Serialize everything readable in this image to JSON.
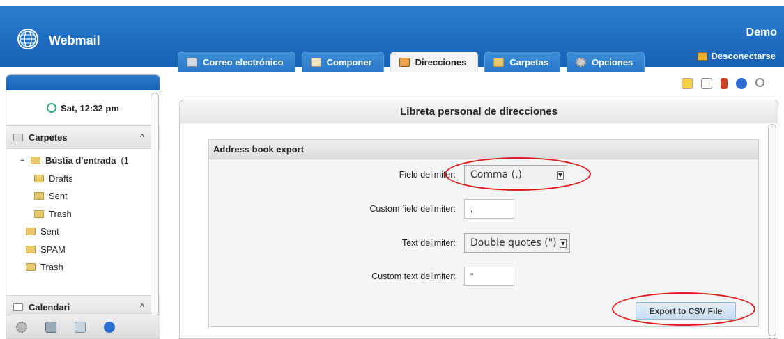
{
  "header": {
    "app_title": "Webmail",
    "user_name": "Demo",
    "logout_label": "Desconectarse",
    "tabs": [
      {
        "label": "Correo electrónico",
        "icon": "mail-icon",
        "active": false
      },
      {
        "label": "Componer",
        "icon": "compose-icon",
        "active": false
      },
      {
        "label": "Direcciones",
        "icon": "addressbook-icon",
        "active": true
      },
      {
        "label": "Carpetas",
        "icon": "folder-icon",
        "active": false
      },
      {
        "label": "Opciones",
        "icon": "gear-icon",
        "active": false
      }
    ]
  },
  "sidebar": {
    "clock": "Sat, 12:32 pm",
    "folders_section": "Carpetes",
    "folders": [
      {
        "label": "Bústia d'entrada",
        "suffix": "(1",
        "bold": true
      },
      {
        "label": "Drafts"
      },
      {
        "label": "Sent"
      },
      {
        "label": "Trash"
      },
      {
        "label": "Sent"
      },
      {
        "label": "SPAM"
      },
      {
        "label": "Trash"
      }
    ],
    "calendar_section": "Calendari"
  },
  "main": {
    "panel_title": "Libreta personal de direcciones",
    "export_box_title": "Address book export",
    "field_delimiter_label": "Field delimiter:",
    "field_delimiter_value": "Comma (,)",
    "custom_field_delimiter_label": "Custom field delimiter:",
    "custom_field_delimiter_value": ",",
    "text_delimiter_label": "Text delimiter:",
    "text_delimiter_value": "Double quotes (\")",
    "custom_text_delimiter_label": "Custom text delimiter:",
    "custom_text_delimiter_value": "\"",
    "export_button_label": "Export to CSV File"
  },
  "colors": {
    "header_blue": "#1f6fc4",
    "annotation_red": "#e01a1a"
  }
}
